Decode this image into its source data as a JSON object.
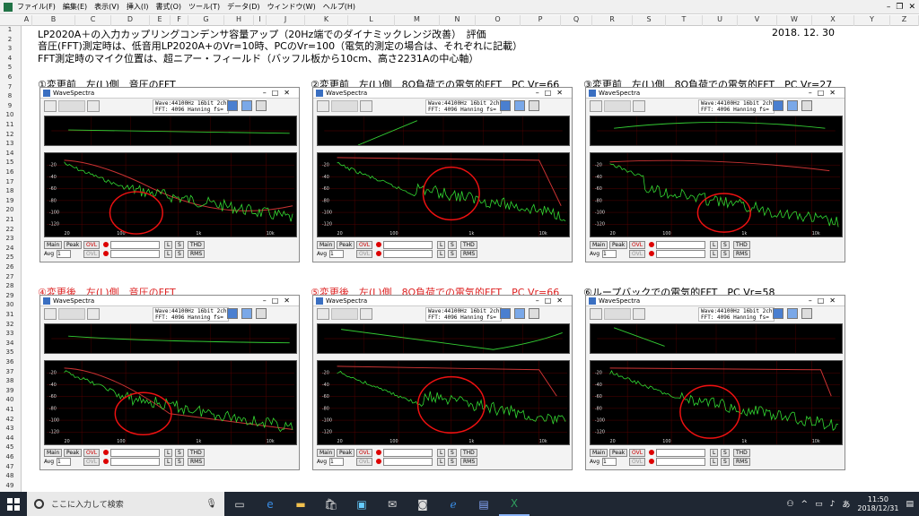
{
  "menu": [
    "ファイル(F)",
    "編集(E)",
    "表示(V)",
    "挿入(I)",
    "書式(O)",
    "ツール(T)",
    "データ(D)",
    "ウィンドウ(W)",
    "ヘルプ(H)"
  ],
  "columns": [
    "A",
    "B",
    "C",
    "D",
    "E",
    "F",
    "G",
    "H",
    "I",
    "J",
    "K",
    "L",
    "M",
    "N",
    "O",
    "P",
    "Q",
    "R",
    "S",
    "T",
    "U",
    "V",
    "W",
    "X",
    "Y",
    "Z"
  ],
  "rows": [
    "1",
    "2",
    "3",
    "4",
    "5",
    "6",
    "7",
    "8",
    "9",
    "10",
    "11",
    "12",
    "13",
    "14",
    "15",
    "16",
    "17",
    "18",
    "19",
    "20",
    "21",
    "22",
    "23",
    "24",
    "25",
    "26",
    "27",
    "28",
    "29",
    "30",
    "31",
    "32",
    "33",
    "34",
    "35",
    "36",
    "37",
    "38",
    "39",
    "40",
    "41",
    "42",
    "43",
    "44",
    "45",
    "46",
    "47",
    "48",
    "49"
  ],
  "sheet": {
    "title": "LP2020A＋の入力カップリングコンデンサ容量アップ（20Hz端でのダイナミックレンジ改善）　評価",
    "date": "2018. 12. 30",
    "note1": "音圧(FFT)測定時は、低音用LP2020A+のVr=10時、PCのVr=100（電気的測定の場合は、それぞれに記載）",
    "note2": "FFT測定時のマイク位置は、超ニアー・フィールド（バッフル板から10cm、高さ2231Aの中心軸）"
  },
  "panels": [
    {
      "label": "①変更前　左(L)側　音圧のFFT",
      "red": false
    },
    {
      "label": "②変更前　左(L)側　8Ω負荷での電気的FFT　PC Vr=66",
      "red": false
    },
    {
      "label": "③変更前　左(L)側　8Ω負荷での電気的FFT　PC Vr=27",
      "red": false
    },
    {
      "label": "④変更後　左(L)側　音圧のFFT",
      "red": true
    },
    {
      "label": "⑤変更後　左(L)側　8Ω負荷での電気的FFT　PC Vr=66",
      "red": true
    },
    {
      "label": "⑥ループバックでの電気的FFT　PC Vr=58",
      "red": false
    }
  ],
  "wavespectra": {
    "title": "WaveSpectra",
    "info1": "Wave:44100Hz 16bit 2ch",
    "info2": "FFT: 4096 Hanning  fs=",
    "main": "Main",
    "peak": "Peak",
    "ovl": "OVL",
    "avg": "Avg",
    "avg_val": "1",
    "l": "L",
    "s": "S",
    "thd": "THD",
    "rms": "RMS",
    "yticks": [
      "-20",
      "-40",
      "-60",
      "-80",
      "-100",
      "-120"
    ],
    "xticks": [
      "20",
      "100",
      "1k",
      "10k"
    ]
  },
  "taskbar": {
    "search_placeholder": "ここに入力して検索",
    "time": "11:50",
    "date": "2018/12/31",
    "ime": "あ"
  }
}
